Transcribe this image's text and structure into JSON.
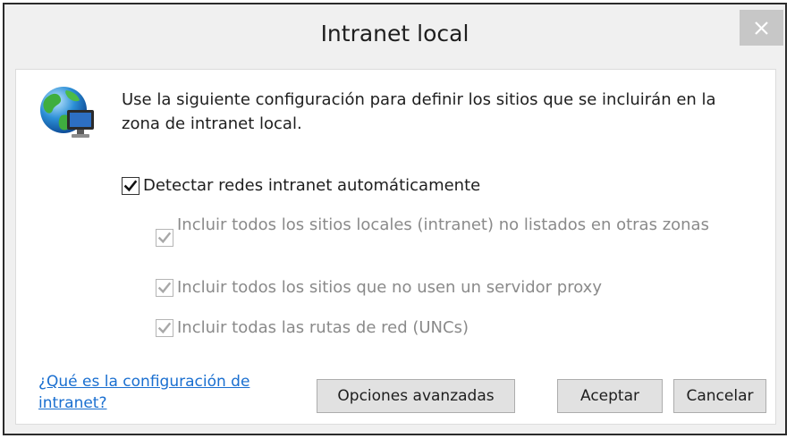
{
  "window": {
    "title": "Intranet local",
    "close_icon": "close-icon"
  },
  "description": "Use la siguiente configuración para definir los sitios que se incluirán en la zona de intranet local.",
  "checkboxes": {
    "auto_detect": {
      "label": "Detectar redes intranet automáticamente",
      "checked": true,
      "enabled": true
    },
    "local_sites": {
      "label": "Incluir todos los sitios locales (intranet) no listados en otras zonas",
      "checked": true,
      "enabled": false
    },
    "no_proxy": {
      "label": "Incluir todos los sitios que no usen un servidor proxy",
      "checked": true,
      "enabled": false
    },
    "unc_paths": {
      "label": "Incluir todas las rutas de red (UNCs)",
      "checked": true,
      "enabled": false
    }
  },
  "help_link": "¿Qué es la configuración de intranet?",
  "buttons": {
    "advanced": "Opciones avanzadas",
    "ok": "Aceptar",
    "cancel": "Cancelar"
  },
  "colors": {
    "link": "#1a6fd0",
    "disabled_text": "#8a8a8a",
    "close_button_bg": "#c7c7c7"
  }
}
